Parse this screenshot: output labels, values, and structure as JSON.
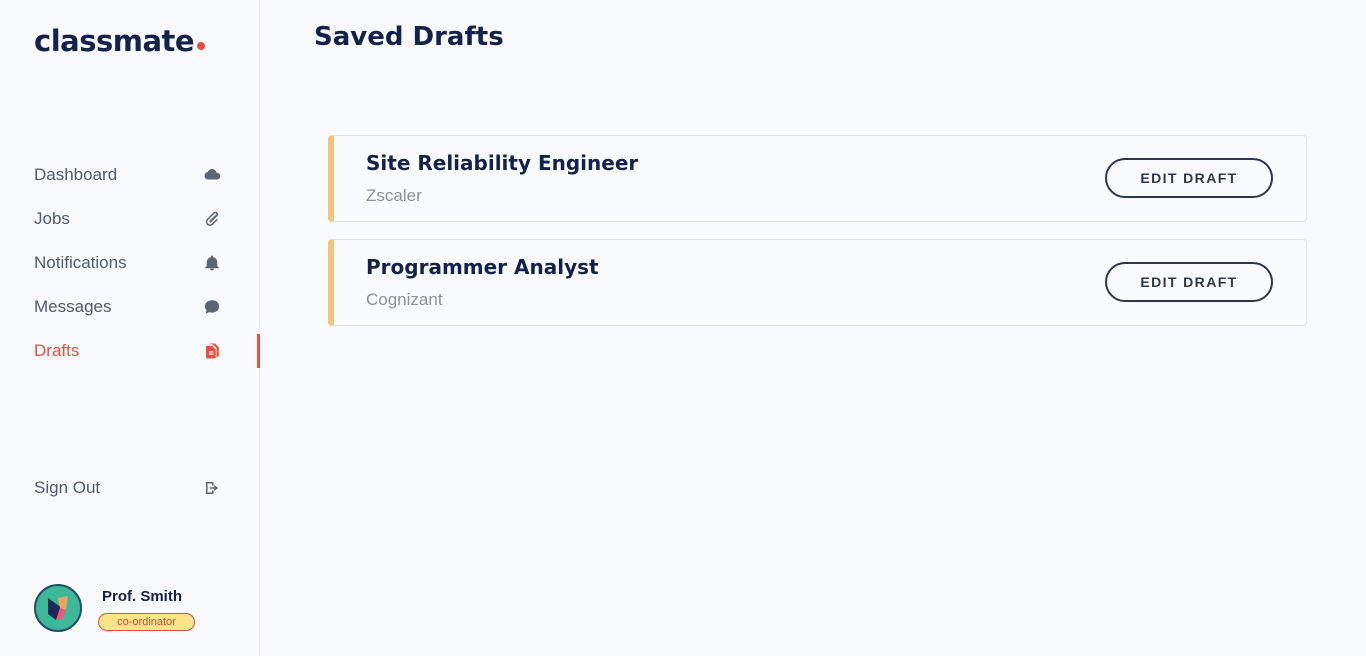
{
  "brand": {
    "name": "classmate",
    "accent_color": "#e2503e"
  },
  "sidebar": {
    "items": [
      {
        "label": "Dashboard",
        "icon": "cloud-icon",
        "active": false
      },
      {
        "label": "Jobs",
        "icon": "paperclip-icon",
        "active": false
      },
      {
        "label": "Notifications",
        "icon": "bell-icon",
        "active": false
      },
      {
        "label": "Messages",
        "icon": "chat-icon",
        "active": false
      },
      {
        "label": "Drafts",
        "icon": "documents-icon",
        "active": true
      }
    ],
    "signout": {
      "label": "Sign Out",
      "icon": "sign-out-icon"
    }
  },
  "profile": {
    "name": "Prof. Smith",
    "role": "co-ordinator"
  },
  "main": {
    "title": "Saved Drafts",
    "drafts": [
      {
        "title": "Site Reliability Engineer",
        "company": "Zscaler",
        "action": "EDIT DRAFT"
      },
      {
        "title": "Programmer Analyst",
        "company": "Cognizant",
        "action": "EDIT DRAFT"
      }
    ]
  }
}
